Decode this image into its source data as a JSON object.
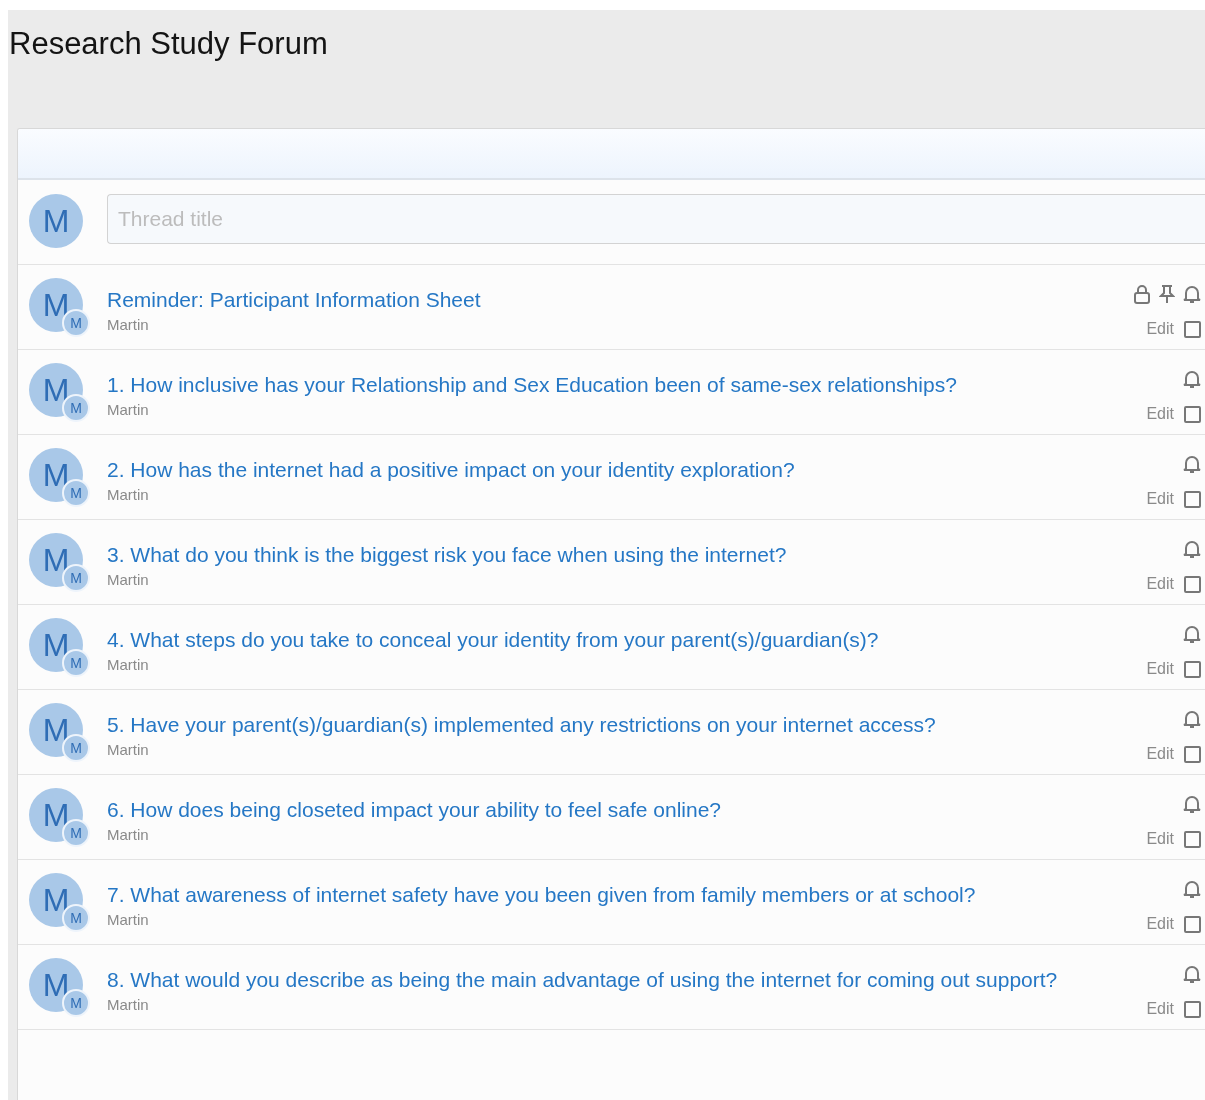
{
  "page_title": "Research Study Forum",
  "new_thread": {
    "avatar": "M",
    "placeholder": "Thread title"
  },
  "threads": [
    {
      "title": "Reminder: Participant Information Sheet",
      "author": "Martin",
      "avatar": "M",
      "badge": "M",
      "locked": true,
      "pinned": true,
      "edit": "Edit",
      "checked": false
    },
    {
      "title": "1. How inclusive has your Relationship and Sex Education been of same-sex relationships?",
      "author": "Martin",
      "avatar": "M",
      "badge": "M",
      "locked": false,
      "pinned": false,
      "edit": "Edit",
      "checked": false
    },
    {
      "title": "2. How has the internet had a positive impact on your identity exploration?",
      "author": "Martin",
      "avatar": "M",
      "badge": "M",
      "locked": false,
      "pinned": false,
      "edit": "Edit",
      "checked": false
    },
    {
      "title": "3. What do you think is the biggest risk you face when using the internet?",
      "author": "Martin",
      "avatar": "M",
      "badge": "M",
      "locked": false,
      "pinned": false,
      "edit": "Edit",
      "checked": false
    },
    {
      "title": "4. What steps do you take to conceal your identity from your parent(s)/guardian(s)?",
      "author": "Martin",
      "avatar": "M",
      "badge": "M",
      "locked": false,
      "pinned": false,
      "edit": "Edit",
      "checked": false
    },
    {
      "title": "5. Have your parent(s)/guardian(s) implemented any restrictions on your internet access?",
      "author": "Martin",
      "avatar": "M",
      "badge": "M",
      "locked": false,
      "pinned": false,
      "edit": "Edit",
      "checked": false
    },
    {
      "title": "6. How does being closeted impact your ability to feel safe online?",
      "author": "Martin",
      "avatar": "M",
      "badge": "M",
      "locked": false,
      "pinned": false,
      "edit": "Edit",
      "checked": false
    },
    {
      "title": "7. What awareness of internet safety have you been given from family members or at school?",
      "author": "Martin",
      "avatar": "M",
      "badge": "M",
      "locked": false,
      "pinned": false,
      "edit": "Edit",
      "checked": false
    },
    {
      "title": "8. What would you describe as being the main advantage of using the internet for coming out support?",
      "author": "Martin",
      "avatar": "M",
      "badge": "M",
      "locked": false,
      "pinned": false,
      "edit": "Edit",
      "checked": false
    }
  ]
}
